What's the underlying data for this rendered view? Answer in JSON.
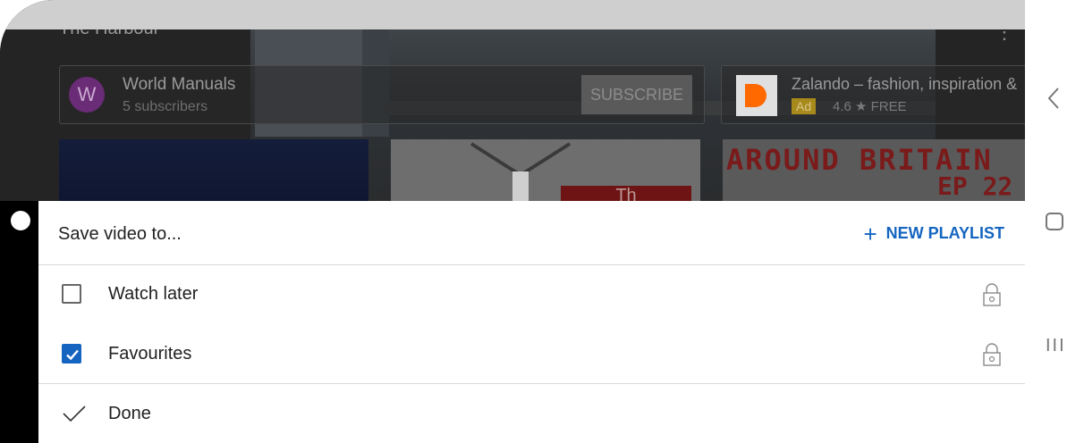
{
  "video": {
    "title": "The Harbour",
    "more_icon": "more-vertical-icon"
  },
  "channel": {
    "avatar_letter": "W",
    "name": "World Manuals",
    "subscribers": "5 subscribers",
    "subscribe_label": "SUBSCRIBE"
  },
  "ad": {
    "title": "Zalando – fashion, inspiration &",
    "badge": "Ad",
    "rating": "4.6 ★ FREE"
  },
  "thumbnails": {
    "thumb2_text": "Th",
    "thumb3_line1": "AROUND BRITAIN",
    "thumb3_line2": "EP 22"
  },
  "sheet": {
    "title": "Save video to...",
    "new_playlist_label": "NEW PLAYLIST",
    "playlists": [
      {
        "label": "Watch later",
        "checked": false,
        "icon": "lock-icon"
      },
      {
        "label": "Favourites",
        "checked": true,
        "icon": "lock-icon"
      }
    ],
    "done_label": "Done"
  },
  "colors": {
    "accent": "#1565c0",
    "text": "#212121"
  },
  "nav": {
    "back_icon": "chevron-left-icon",
    "home_icon": "home-square-icon",
    "recents_icon": "recent-apps-icon"
  }
}
